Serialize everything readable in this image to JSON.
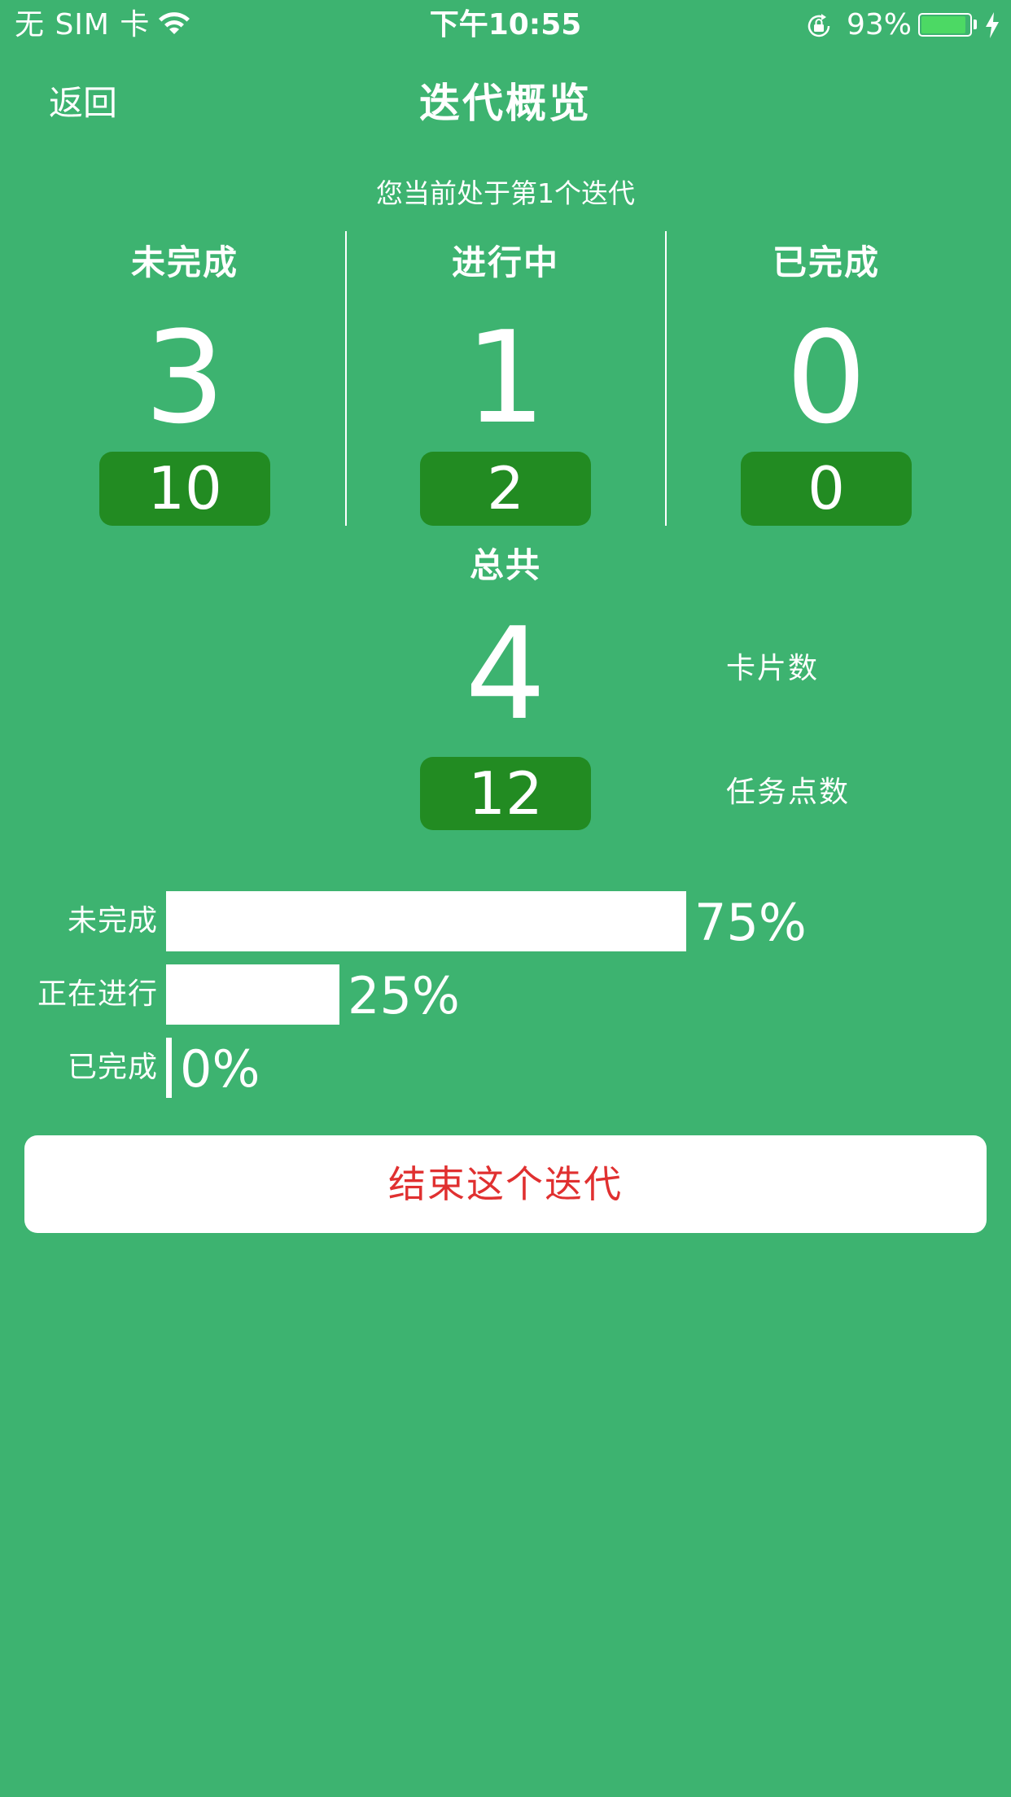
{
  "status_bar": {
    "carrier": "无 SIM 卡",
    "time": "下午10:55",
    "battery_percent": "93%",
    "battery_level": 0.93,
    "icons": [
      "wifi-icon",
      "rotation-lock-icon",
      "battery-icon",
      "charging-bolt-icon"
    ]
  },
  "nav": {
    "back_label": "返回",
    "title": "迭代概览"
  },
  "iteration_notice": "您当前处于第1个迭代",
  "columns": [
    {
      "label": "未完成",
      "count": "3",
      "points": "10"
    },
    {
      "label": "进行中",
      "count": "1",
      "points": "2"
    },
    {
      "label": "已完成",
      "count": "0",
      "points": "0"
    }
  ],
  "total": {
    "label": "总共",
    "count": "4",
    "count_label": "卡片数",
    "points": "12",
    "points_label": "任务点数"
  },
  "progress": [
    {
      "label": "未完成",
      "percent_text": "75%",
      "fraction": 0.75
    },
    {
      "label": "正在进行",
      "percent_text": "25%",
      "fraction": 0.25
    },
    {
      "label": "已完成",
      "percent_text": "0%",
      "fraction": 0
    }
  ],
  "end_button_label": "结束这个迭代",
  "colors": {
    "background": "#3db370",
    "badge": "#228b22",
    "danger_text": "#e03030",
    "battery_fill": "#4cd964"
  }
}
